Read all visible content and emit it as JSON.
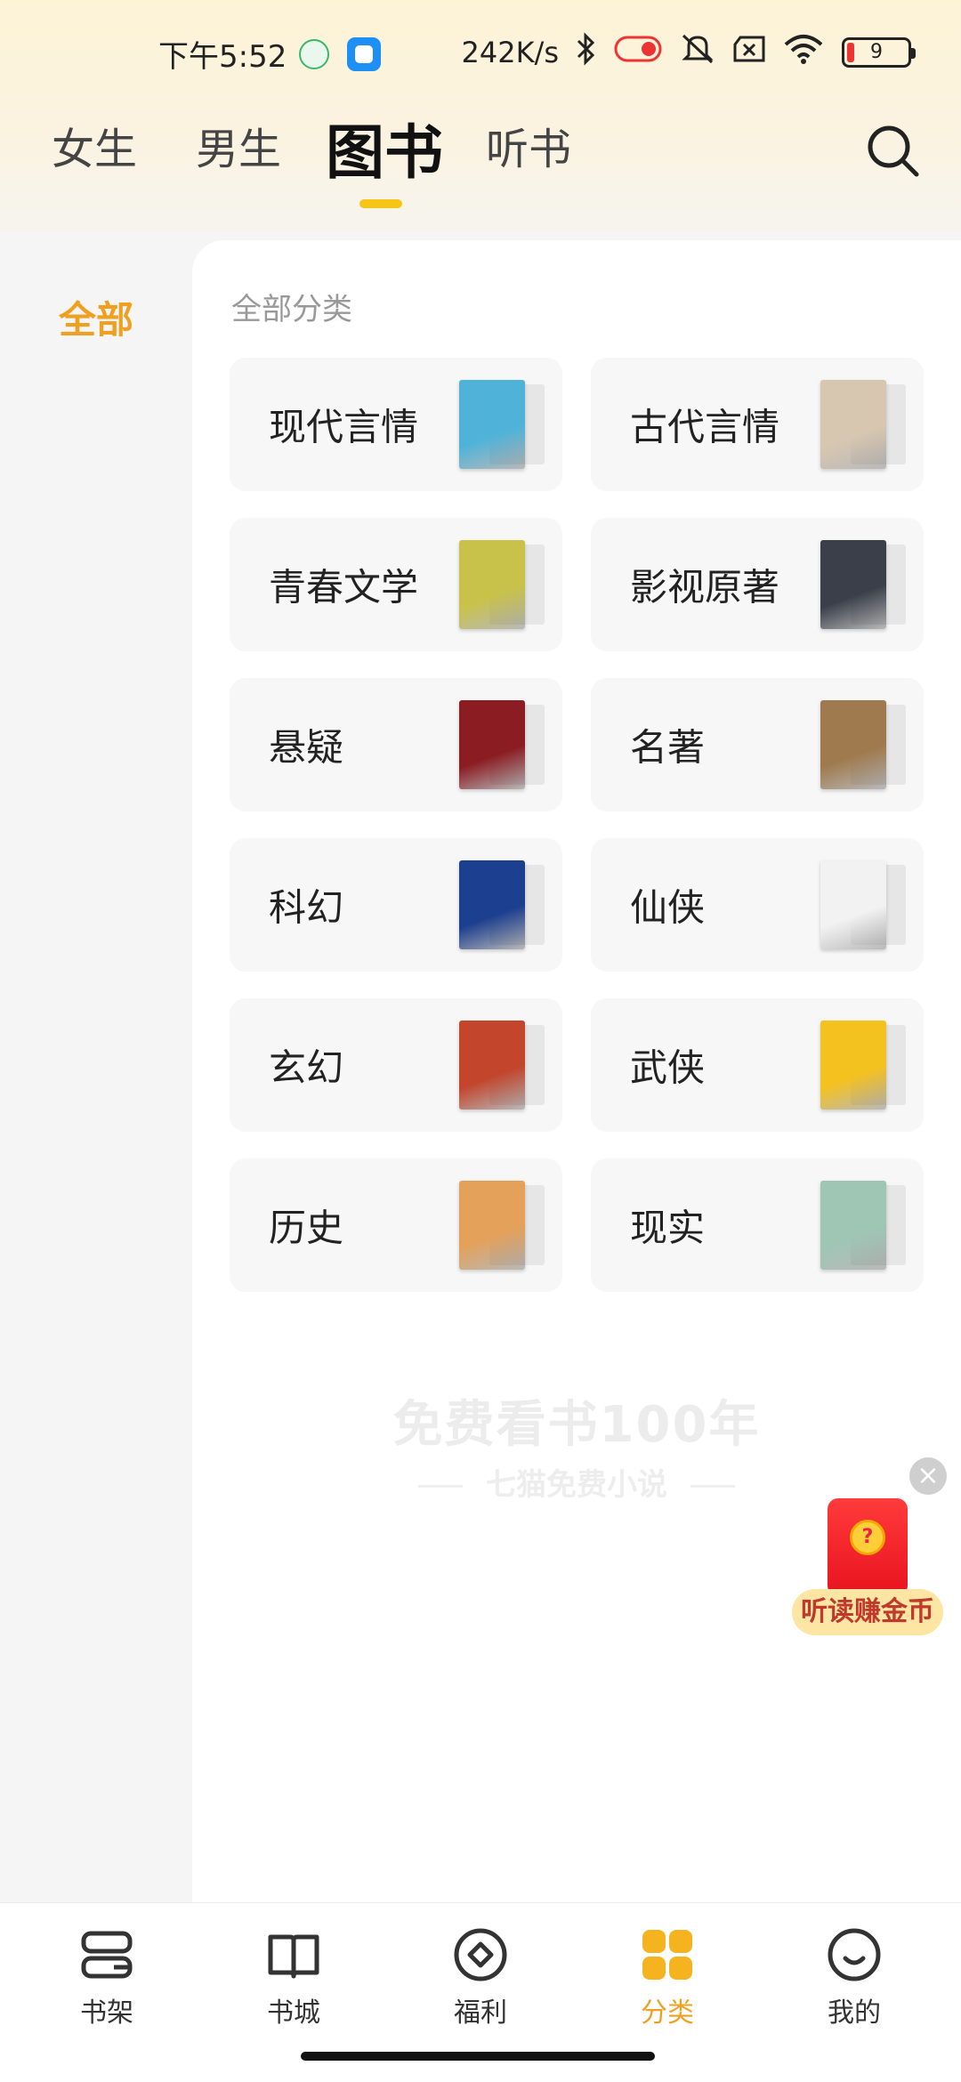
{
  "status_bar": {
    "time": "下午5:52",
    "network_speed": "242K/s",
    "battery_level": "9"
  },
  "tabs": [
    {
      "label": "女生",
      "active": false
    },
    {
      "label": "男生",
      "active": false
    },
    {
      "label": "图书",
      "active": true
    },
    {
      "label": "听书",
      "active": false
    }
  ],
  "sidebar": {
    "items": [
      {
        "label": "全部",
        "active": true
      }
    ]
  },
  "main": {
    "section_title": "全部分类",
    "categories": [
      {
        "label": "现代言情",
        "cover_color": "#4fb3d9"
      },
      {
        "label": "古代言情",
        "cover_color": "#d8c7b0"
      },
      {
        "label": "青春文学",
        "cover_color": "#c9c24a"
      },
      {
        "label": "影视原著",
        "cover_color": "#3a3f4a"
      },
      {
        "label": "悬疑",
        "cover_color": "#8a1c22"
      },
      {
        "label": "名著",
        "cover_color": "#a07a4f"
      },
      {
        "label": "科幻",
        "cover_color": "#1d3f8f"
      },
      {
        "label": "仙侠",
        "cover_color": "#f2f2f2"
      },
      {
        "label": "玄幻",
        "cover_color": "#c2452c"
      },
      {
        "label": "武侠",
        "cover_color": "#f4c21f"
      },
      {
        "label": "历史",
        "cover_color": "#e3a15a"
      },
      {
        "label": "现实",
        "cover_color": "#9fc6b5"
      }
    ]
  },
  "watermark": {
    "line1": "免费看书100年",
    "line2": "七猫免费小说"
  },
  "promo": {
    "label": "听读赚金币"
  },
  "bottom_nav": [
    {
      "label": "书架",
      "icon": "bookshelf-icon",
      "active": false
    },
    {
      "label": "书城",
      "icon": "book-open-icon",
      "active": false
    },
    {
      "label": "福利",
      "icon": "reward-icon",
      "active": false
    },
    {
      "label": "分类",
      "icon": "category-grid-icon",
      "active": true
    },
    {
      "label": "我的",
      "icon": "profile-smile-icon",
      "active": false
    }
  ],
  "colors": {
    "accent": "#f0a020",
    "tab_indicator": "#f5c518"
  }
}
